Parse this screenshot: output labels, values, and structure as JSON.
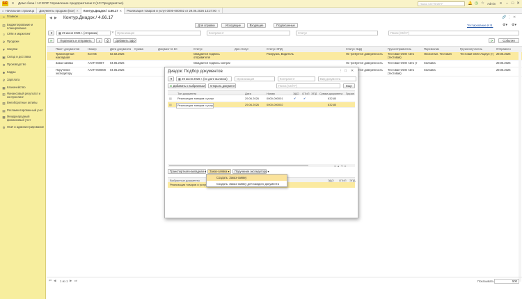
{
  "window": {
    "logo": "1С",
    "title": "Демо база / 1С:ERP Управление предприятием 2  (1С:Предприятие)",
    "search_placeholder": "Поиск Ctrl+Shift+F",
    "user": "Admin"
  },
  "tabs": [
    {
      "label": "Начальная страница"
    },
    {
      "label": "Документы продажи (все)"
    },
    {
      "label": "Контур.Диадок / 4.66.17"
    },
    {
      "label": "Реализация товаров и услуг 0000-000002 от 29.06.2026 13:27:00"
    }
  ],
  "sidebar": [
    {
      "icon": "≡",
      "label": "Главное"
    },
    {
      "icon": "▤",
      "label": "Бюджетирование и планирование"
    },
    {
      "icon": "☺",
      "label": "CRM и маркетинг"
    },
    {
      "icon": "₽",
      "label": "Продажи"
    },
    {
      "icon": "🛒",
      "label": "Закупки"
    },
    {
      "icon": "▣",
      "label": "Склад и доставка"
    },
    {
      "icon": "⚙",
      "label": "Производство"
    },
    {
      "icon": "☻",
      "label": "Кадры"
    },
    {
      "icon": "₽",
      "label": "Зарплата"
    },
    {
      "icon": "▦",
      "label": "Казначейство"
    },
    {
      "icon": "▥",
      "label": "Финансовый результат и контроллинг"
    },
    {
      "icon": "▧",
      "label": "Внеоборотные активы"
    },
    {
      "icon": "▤",
      "label": "Регламентированный учет"
    },
    {
      "icon": "▩",
      "label": "Международный финансовый учет"
    },
    {
      "icon": "⚙",
      "label": "НСИ и администрирование"
    }
  ],
  "main": {
    "title": "Контур.Диадок / 4.66.17",
    "buttons": {
      "help": "Для справки",
      "outgoing": "Исходящие",
      "incoming": "Входящие",
      "signable": "Подписанные",
      "sign_send": "Подписать и отправить",
      "add_edo": "Добавить ЭДО",
      "actions": "События"
    },
    "filter": {
      "period": "29 июня 2026 г. (отправка)",
      "org_placeholder": "Организация",
      "counterparty_placeholder": "Контрагент",
      "status_placeholder": "Статус",
      "search_placeholder": "Поиск (Ctrl+F)"
    },
    "account_link": "Тестирование И.В.",
    "columns": [
      "Пакет документов",
      "Номер",
      "Дата документа",
      "Сумма",
      "Документ в 1С",
      "Статус",
      "Доп.статус",
      "Статус ЭПД",
      "Статус ЭЦД",
      "Грузоотправитель",
      "Перевозчик",
      "Грузополучатель",
      "Отправлен"
    ],
    "rows": [
      {
        "package": "Транспортная накладная",
        "number": "Кон-05",
        "date": "02.02.2026",
        "sum": "",
        "doc1c": "",
        "status": "Ожидается подпись отправителя",
        "extra": "",
        "epd": "Разгрузка, Водитель",
        "ecd": "Не требуется доверенность",
        "shipper": "Тестовая ООО Авто (тестовая)",
        "carrier": "Лесной мл. Тестовая",
        "consignee": "Тестовая ООО Акцпун (т)",
        "sent": "29.06.2026",
        "selected": true
      },
      {
        "package": "Заказ-заявка",
        "number": "ААУП-00067",
        "date": "04.06.2026",
        "sum": "",
        "doc1c": "",
        "status": "Ожидается подпись контраг",
        "extra": "",
        "epd": "",
        "ecd": "Не требуется доверенность",
        "shipper": "Тестовая ООО Авто (т",
        "carrier": "Sezzaika",
        "consignee": "",
        "sent": "29.06.2026",
        "selected": false
      },
      {
        "package": "Поручение экспедитору",
        "number": "ААУП-000008",
        "date": "04.06.2026",
        "sum": "",
        "doc1c": "",
        "status": "Ожидается подпись отправителя",
        "extra": "",
        "epd": "",
        "ecd": "Не требуется доверенность",
        "shipper": "Тестовая ООО Авто (тестовая)",
        "carrier": "Sezzaika",
        "consignee": "",
        "sent": "29.06.2026",
        "selected": false
      }
    ],
    "footer": {
      "pager": "1 из 1",
      "page_size_label": "Показывать:",
      "page_size": "500"
    }
  },
  "dialog": {
    "title": "Диадок: Подбор документов",
    "period": "29 июня 2026 г. (по дате выписки)",
    "org_placeholder": "Организация",
    "counterparty_placeholder": "Контрагент",
    "type_placeholder": "Вид документа",
    "search_placeholder": "Поиск (Ctrl+F)",
    "more": "Еще",
    "add_selected": "Добавить к выбранным",
    "open_doc": "Открыть документ",
    "columns": [
      "Тип документа",
      "Дата",
      "Номер",
      "ЭДО",
      "ОТиП",
      "ЭПД",
      "Сумма документа",
      "Грузоп"
    ],
    "rows": [
      {
        "type": "Реализация товаров и услуг",
        "date": "29.06.2026",
        "number": "0000-000001",
        "edo": "✔",
        "otip": "✔",
        "epd": "",
        "sum": "632,80",
        "selected": false
      },
      {
        "type": "Реализация товаров и услуг",
        "date": "29.06.2026",
        "number": "0000-000002",
        "edo": "",
        "otip": "",
        "epd": "",
        "sum": "632,80",
        "selected": true
      }
    ],
    "tabs": [
      "Транспортная накладная",
      "Заказ-заявка",
      "Поручение экспедитору"
    ],
    "selected_docs": {
      "label": "Выбранные документы",
      "row": "Реализация товаров и услуг 0",
      "columns": [
        "ЭДО",
        "ОТиП",
        "ЭПД"
      ]
    }
  },
  "dropdown": {
    "items": [
      "Создать: Заказ-заявку",
      "Создать: Заказ-заявку для каждого документа"
    ]
  }
}
